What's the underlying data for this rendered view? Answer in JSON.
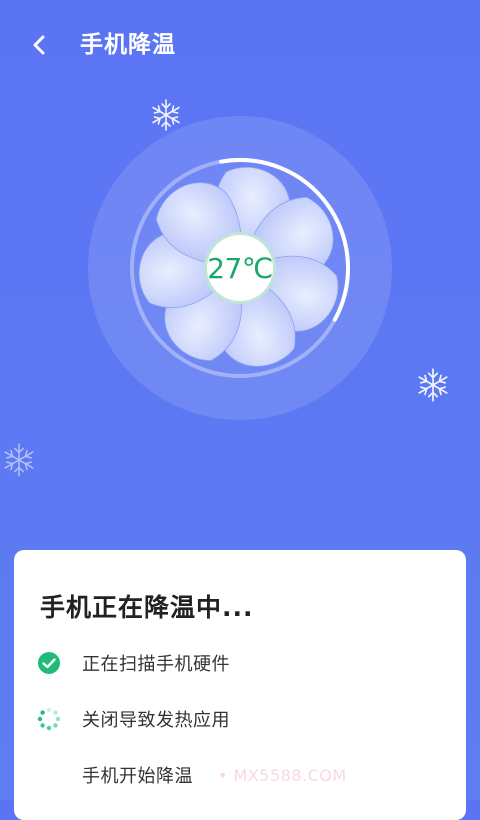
{
  "header": {
    "title": "手机降温",
    "back_icon": "chevron-left-icon"
  },
  "fan": {
    "temperature": "27℃",
    "progress": 0.85
  },
  "card": {
    "title": "手机正在降温中...",
    "steps": [
      {
        "label": "正在扫描手机硬件",
        "status": "done",
        "icon": "check-circle-icon"
      },
      {
        "label": "关闭导致发热应用",
        "status": "in-progress",
        "icon": "spinner-icon"
      },
      {
        "label": "手机开始降温",
        "status": "pending",
        "icon": ""
      }
    ]
  },
  "watermark": "• MX5588.COM",
  "colors": {
    "background": "#5b74f4",
    "accent_green": "#1fbb77",
    "temp_text": "#17a86c",
    "card": "#ffffff"
  }
}
